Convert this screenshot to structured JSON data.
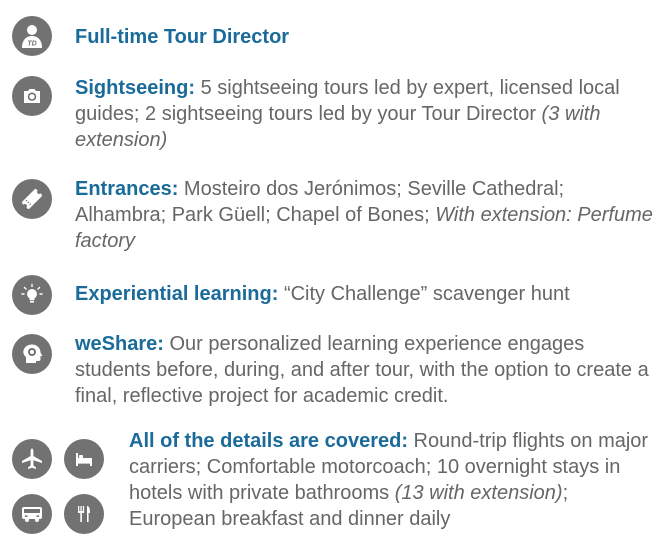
{
  "accent_color": "#1a6a9a",
  "icon_color": "#727272",
  "items": [
    {
      "icon": "tour-director-icon",
      "icon_label": "TD",
      "heading": "Full-time Tour Director",
      "body": "",
      "note": "",
      "tail": ""
    },
    {
      "icon": "camera-icon",
      "heading": "Sightseeing:",
      "body": " 5 sightseeing tours led by expert, licensed local guides; 2 sightseeing tours led by your Tour Director ",
      "note": "(3 with extension)",
      "tail": ""
    },
    {
      "icon": "ticket-icon",
      "heading": "Entrances:",
      "body": " Mosteiro dos Jerónimos; Seville Cathedral; Alhambra; Park Güell; Chapel of Bones; ",
      "note": "With extension: Perfume factory",
      "tail": ""
    },
    {
      "icon": "lightbulb-icon",
      "heading": "Experiential learning:",
      "body": " “City Challenge” scavenger hunt",
      "note": "",
      "tail": ""
    },
    {
      "icon": "head-icon",
      "heading": "weShare:",
      "body": " Our personalized learning experience engages students before, during, and after tour, with the option to create a final, reflective project for academic credit.",
      "note": "",
      "tail": ""
    },
    {
      "icons": [
        "airplane-icon",
        "bed-icon",
        "bus-icon",
        "fork-knife-icon"
      ],
      "heading": "All of the details are covered:",
      "body": " Round-trip flights on major carriers; Comfortable motorcoach; 10 overnight stays in hotels with private bathrooms ",
      "note": "(13 with extension)",
      "tail": "; European breakfast and dinner daily"
    }
  ]
}
